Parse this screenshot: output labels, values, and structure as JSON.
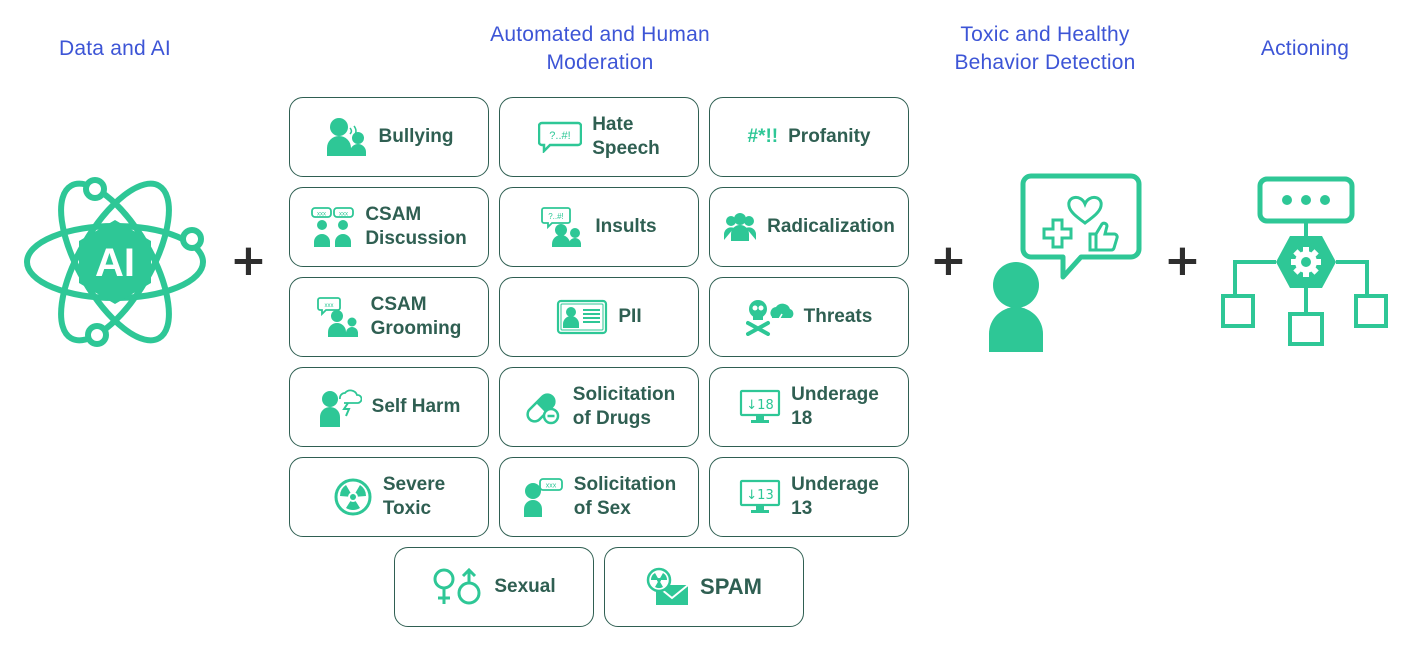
{
  "colors": {
    "heading": "#3d55d6",
    "accent_green": "#2ec796",
    "card_border": "#2f5f52",
    "card_text": "#2f5f52",
    "plus": "#2e2e2e"
  },
  "columns": {
    "data_ai": {
      "title": "Data and AI",
      "icon": "atom-ai-icon",
      "icon_text": "AI"
    },
    "moderation": {
      "title_line1": "Automated and Human",
      "title_line2": "Moderation"
    },
    "detection": {
      "title_line1": "Toxic and Healthy",
      "title_line2": "Behavior Detection",
      "icon": "person-speech-bubble-icon"
    },
    "actioning": {
      "title": "Actioning",
      "icon": "workflow-hierarchy-icon"
    }
  },
  "operators": [
    "+",
    "+",
    "+"
  ],
  "categories": [
    {
      "label1": "Bullying",
      "label2": "",
      "icon": "bullying-icon"
    },
    {
      "label1": "Hate",
      "label2": "Speech",
      "icon": "hate-speech-icon",
      "icon_text": "?..#!"
    },
    {
      "label1": "Profanity",
      "label2": "",
      "icon": "profanity-icon",
      "icon_text": "#*!!"
    },
    {
      "label1": "CSAM",
      "label2": "Discussion",
      "icon": "csam-discussion-icon",
      "icon_text": "xxx"
    },
    {
      "label1": "Insults",
      "label2": "",
      "icon": "insults-icon",
      "icon_text": "?..#!"
    },
    {
      "label1": "Radicalization",
      "label2": "",
      "icon": "group-icon"
    },
    {
      "label1": "CSAM",
      "label2": "Grooming",
      "icon": "csam-grooming-icon",
      "icon_text": "xxx"
    },
    {
      "label1": "PII",
      "label2": "",
      "icon": "id-card-icon"
    },
    {
      "label1": "Threats",
      "label2": "",
      "icon": "skull-storm-icon"
    },
    {
      "label1": "Self Harm",
      "label2": "",
      "icon": "self-harm-icon"
    },
    {
      "label1": "Solicitation",
      "label2": "of Drugs",
      "icon": "pill-icon"
    },
    {
      "label1": "Underage",
      "label2": "18",
      "icon": "monitor-18-icon",
      "icon_text": "↓18"
    },
    {
      "label1": "Severe",
      "label2": "Toxic",
      "icon": "radiation-icon"
    },
    {
      "label1": "Solicitation",
      "label2": "of Sex",
      "icon": "solicitation-sex-icon",
      "icon_text": "xxx"
    },
    {
      "label1": "Underage",
      "label2": "13",
      "icon": "monitor-13-icon",
      "icon_text": "↓13"
    },
    {
      "label1": "Sexual",
      "label2": "",
      "icon": "gender-symbols-icon"
    },
    {
      "label1": "SPAM",
      "label2": "",
      "icon": "spam-icon"
    }
  ]
}
